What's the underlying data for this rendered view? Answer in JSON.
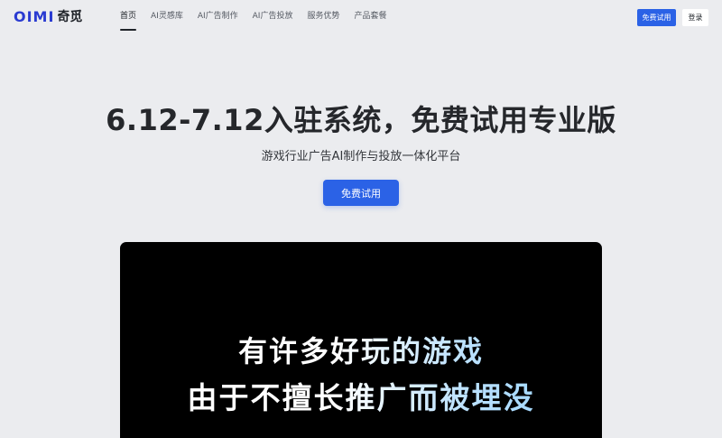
{
  "brand": {
    "logo_mark": "OIMI",
    "logo_cn": "奇觅"
  },
  "nav": {
    "items": [
      {
        "label": "首页",
        "active": true
      },
      {
        "label": "AI灵感库",
        "active": false
      },
      {
        "label": "AI广告制作",
        "active": false
      },
      {
        "label": "AI广告投放",
        "active": false
      },
      {
        "label": "服务优势",
        "active": false
      },
      {
        "label": "产品套餐",
        "active": false
      }
    ]
  },
  "header_actions": {
    "trial_label": "免费试用",
    "login_label": "登录"
  },
  "hero": {
    "title": "6.12-7.12入驻系统，免费试用专业版",
    "subtitle": "游戏行业广告AI制作与投放一体化平台",
    "cta_label": "免费试用"
  },
  "video": {
    "line1": "有许多好玩的游戏",
    "line2": "由于不擅长推广而被埋没"
  },
  "colors": {
    "accent": "#2b62e6",
    "background": "#ebecef",
    "video_bg": "#000000"
  }
}
